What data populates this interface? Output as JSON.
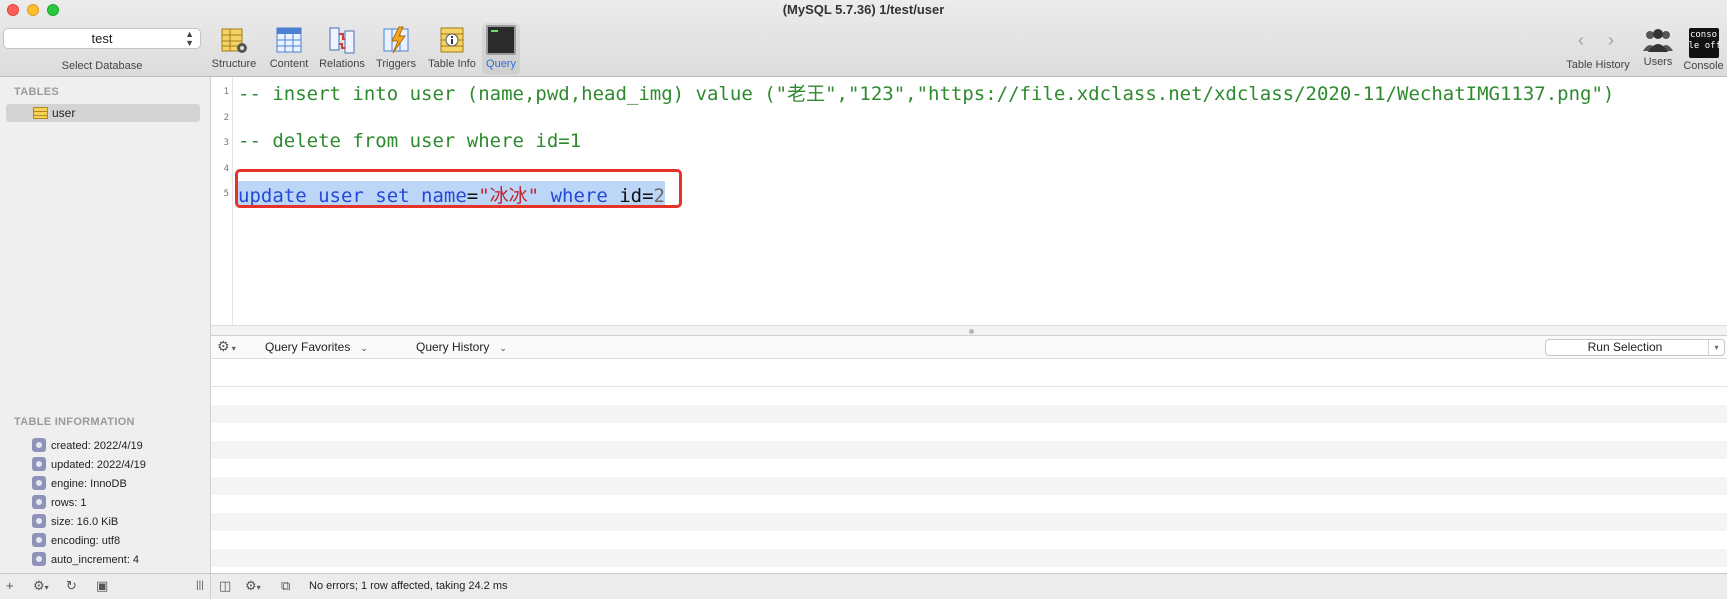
{
  "window": {
    "title": "(MySQL 5.7.36) 1/test/user"
  },
  "database_selector": {
    "value": "test",
    "caption": "Select Database"
  },
  "toolbar": {
    "tabs": [
      {
        "label": "Structure",
        "icon": "structure-icon"
      },
      {
        "label": "Content",
        "icon": "content-icon"
      },
      {
        "label": "Relations",
        "icon": "relations-icon"
      },
      {
        "label": "Triggers",
        "icon": "triggers-icon"
      },
      {
        "label": "Table Info",
        "icon": "table-info-icon"
      },
      {
        "label": "Query",
        "icon": "terminal-icon",
        "active": true
      }
    ],
    "right": [
      {
        "label": "Table History",
        "icon": "back-forward-icon"
      },
      {
        "label": "Users",
        "icon": "users-icon"
      },
      {
        "label": "Console",
        "icon": "console-icon",
        "icon_text_1": "conso",
        "icon_text_2": "le off"
      }
    ]
  },
  "sidebar": {
    "tables_heading": "TABLES",
    "tables": [
      {
        "name": "user",
        "selected": true
      }
    ],
    "table_info_heading": "TABLE INFORMATION",
    "table_info": [
      "created: 2022/4/19",
      "updated: 2022/4/19",
      "engine: InnoDB",
      "rows: 1",
      "size: 16.0 KiB",
      "encoding: utf8",
      "auto_increment: 4"
    ]
  },
  "editor": {
    "line_numbers": [
      "1",
      "2",
      "3",
      "4",
      "5"
    ],
    "line1": "-- insert into user (name,pwd,head_img) value (\"老王\",\"123\",\"https://file.xdclass.net/xdclass/2020-11/WechatIMG1137.png\")",
    "line3": "-- delete from user where id=1",
    "line5": {
      "t1": "update user set name",
      "t2": "=",
      "t3": "\"冰冰\"",
      "t4": " where ",
      "t5": "id=",
      "t6": "2"
    }
  },
  "query_bar": {
    "favorites_label": "Query Favorites",
    "history_label": "Query History",
    "run_label": "Run Selection"
  },
  "status": {
    "text": "No errors; 1 row affected, taking 24.2 ms"
  },
  "colors": {
    "accent": "#2a6fdb",
    "comment": "#2e8a2e",
    "keyword": "#2649d8",
    "string": "#c0242d",
    "highlight_border": "#e5332a",
    "selection": "#bcd6f8"
  }
}
